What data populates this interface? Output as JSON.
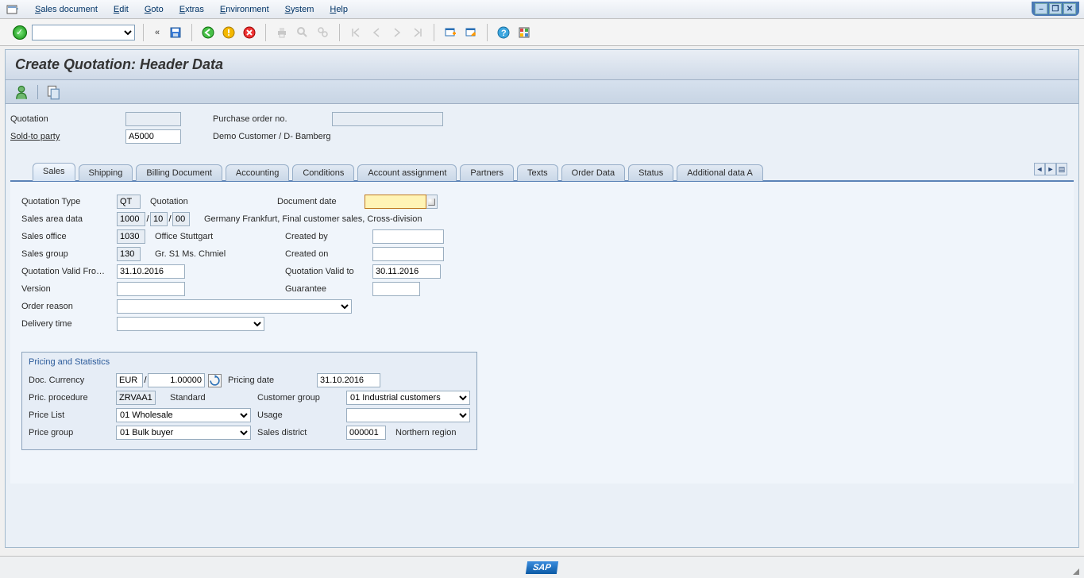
{
  "menu": [
    "Sales document",
    "Edit",
    "Goto",
    "Extras",
    "Environment",
    "System",
    "Help"
  ],
  "title": "Create Quotation: Header Data",
  "header": {
    "quotation_lbl": "Quotation",
    "quotation_val": "",
    "po_lbl": "Purchase order no.",
    "po_val": "",
    "soldto_lbl": "Sold-to party",
    "soldto_val": "A5000",
    "soldto_desc": "Demo Customer / D- Bamberg"
  },
  "tabs": [
    "Sales",
    "Shipping",
    "Billing Document",
    "Accounting",
    "Conditions",
    "Account assignment",
    "Partners",
    "Texts",
    "Order Data",
    "Status",
    "Additional data A"
  ],
  "sales": {
    "qt_type_lbl": "Quotation Type",
    "qt_type_val": "QT",
    "qt_type_desc": "Quotation",
    "docdate_lbl": "Document date",
    "docdate_val": "",
    "area_lbl": "Sales area data",
    "area_v1": "1000",
    "area_v2": "10",
    "area_v3": "00",
    "area_desc": "Germany Frankfurt, Final customer sales, Cross-division",
    "office_lbl": "Sales office",
    "office_val": "1030",
    "office_desc": "Office Stuttgart",
    "createdby_lbl": "Created by",
    "createdby_val": "",
    "group_lbl": "Sales group",
    "group_val": "130",
    "group_desc": "Gr. S1 Ms. Chmiel",
    "createdon_lbl": "Created on",
    "createdon_val": "",
    "validfrom_lbl": "Quotation Valid Fro…",
    "validfrom_val": "31.10.2016",
    "validto_lbl": "Quotation Valid to",
    "validto_val": "30.11.2016",
    "version_lbl": "Version",
    "version_val": "",
    "guarantee_lbl": "Guarantee",
    "guarantee_val": "",
    "orderreason_lbl": "Order reason",
    "orderreason_val": "",
    "deliverytime_lbl": "Delivery time",
    "deliverytime_val": ""
  },
  "pricing": {
    "gb_title": "Pricing and Statistics",
    "doccur_lbl": "Doc. Currency",
    "doccur_val": "EUR",
    "rate_val": "1.00000",
    "pricdate_lbl": "Pricing date",
    "pricdate_val": "31.10.2016",
    "procedure_lbl": "Pric. procedure",
    "procedure_val": "ZRVAA1",
    "procedure_desc": "Standard",
    "custgrp_lbl": "Customer group",
    "custgrp_val": "01 Industrial customers",
    "pricelist_lbl": "Price List",
    "pricelist_val": "01 Wholesale",
    "usage_lbl": "Usage",
    "usage_val": "",
    "pricegrp_lbl": "Price group",
    "pricegrp_val": "01 Bulk buyer",
    "district_lbl": "Sales district",
    "district_val": "000001",
    "district_desc": "Northern region"
  },
  "logo": "SAP"
}
